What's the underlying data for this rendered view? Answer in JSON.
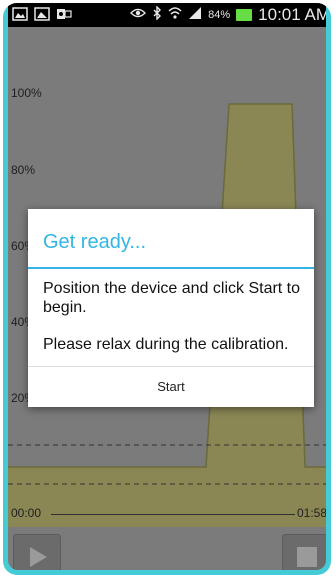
{
  "status_bar": {
    "left_icons": [
      "gallery-icon",
      "image-icon",
      "outlook-icon"
    ],
    "right_icons": [
      "eye-icon",
      "bluetooth-icon",
      "wifi-icon",
      "signal-icon"
    ],
    "battery_percent": "84%",
    "time": "10:01 AM"
  },
  "chart": {
    "y_labels": [
      "100%",
      "80%",
      "60%",
      "40%",
      "20%"
    ],
    "fill_color": "#8a8755",
    "line_color": "#6a6a3a"
  },
  "playback": {
    "time_start": "00:00",
    "time_end": "01:58",
    "play_icon": "play-icon",
    "stop_icon": "stop-icon"
  },
  "dialog": {
    "title": "Get ready...",
    "message": "Position the device and click Start to begin.",
    "message2": "Please relax during the calibration.",
    "start_label": "Start",
    "accent_color": "#33b5e5"
  }
}
